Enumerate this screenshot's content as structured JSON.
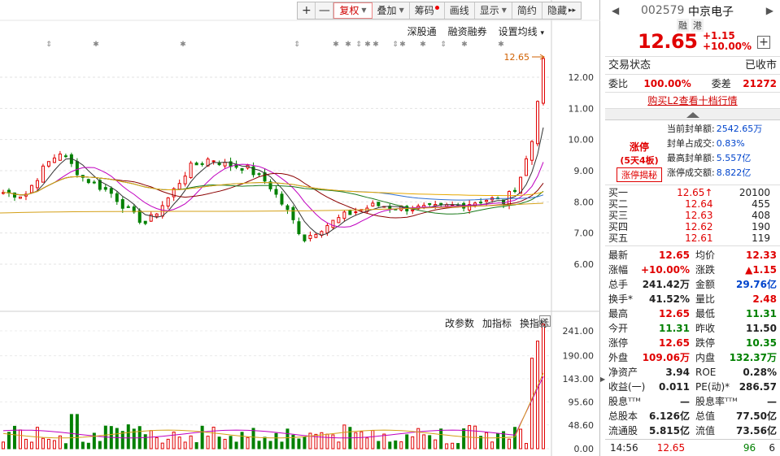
{
  "toolbar": {
    "plus": "+",
    "minus": "—",
    "fuquan": "复权",
    "diejia": "叠加",
    "chouma": "筹码",
    "huaxian": "画线",
    "xianshi": "显示",
    "jianyue": "简约",
    "yincang": "隐藏",
    "more": "▸▸"
  },
  "submenu": {
    "shengutong": "深股通",
    "rongzi": "融资融券",
    "junxian": "设置均线",
    "junxian_caret": "▾"
  },
  "indicator_menu": {
    "gaicanshu": "改参数",
    "jiazhibiao": "加指标",
    "huanzhibiao": "换指标",
    "close": "×"
  },
  "price_axis": [
    "12.00",
    "11.00",
    "10.00",
    "9.00",
    "8.00",
    "7.00",
    "6.00"
  ],
  "volume_axis": [
    "241.00",
    "190.00",
    "143.00",
    "95.60",
    "48.60",
    "0.00"
  ],
  "last_price_label": "12.65",
  "edge_toggle": "▶",
  "quote": {
    "prev": "◀",
    "next": "▶",
    "code": "002579",
    "name": "中京电子",
    "tag_rong": "融",
    "tag_gang": "港",
    "price": "12.65",
    "change": "+1.15",
    "change_pct": "+10.00%",
    "add": "+",
    "status_label": "交易状态",
    "status_value": "已收市",
    "weibi_label": "委比",
    "weibi_value": "100.00%",
    "weicha_label": "委差",
    "weicha_value": "21272",
    "l2_link": "购买L2查看十档行情",
    "limit": {
      "title": "涨停",
      "days": "(5天4板)",
      "button": "涨停揭秘",
      "rows": [
        {
          "k": "当前封单额:",
          "v": "2542.65万"
        },
        {
          "k": "封单占成交:",
          "v": "0.83%"
        },
        {
          "k": "最高封单额:",
          "v": "5.557亿"
        },
        {
          "k": "涨停成交额:",
          "v": "8.822亿"
        }
      ]
    },
    "book": [
      {
        "label": "买一",
        "price": "12.65↑",
        "vol": "20100"
      },
      {
        "label": "买二",
        "price": "12.64",
        "vol": "455"
      },
      {
        "label": "买三",
        "price": "12.63",
        "vol": "408"
      },
      {
        "label": "买四",
        "price": "12.62",
        "vol": "190"
      },
      {
        "label": "买五",
        "price": "12.61",
        "vol": "119"
      }
    ],
    "stats": [
      {
        "k1": "最新",
        "v1": "12.65",
        "c1": "red",
        "k2": "均价",
        "v2": "12.33",
        "c2": "red"
      },
      {
        "k1": "涨幅",
        "v1": "+10.00%",
        "c1": "red",
        "k2": "涨跌",
        "v2": "▲1.15",
        "c2": "red"
      },
      {
        "k1": "总手",
        "v1": "241.42万",
        "c1": "",
        "k2": "金额",
        "v2": "29.76亿",
        "c2": "blue"
      },
      {
        "k1": "换手*",
        "v1": "41.52%",
        "c1": "",
        "k2": "量比",
        "v2": "2.48",
        "c2": "red"
      },
      {
        "k1": "最高",
        "v1": "12.65",
        "c1": "red",
        "k2": "最低",
        "v2": "11.31",
        "c2": "green"
      },
      {
        "k1": "今开",
        "v1": "11.31",
        "c1": "green",
        "k2": "昨收",
        "v2": "11.50",
        "c2": ""
      },
      {
        "k1": "涨停",
        "v1": "12.65",
        "c1": "red",
        "k2": "跌停",
        "v2": "10.35",
        "c2": "green"
      },
      {
        "k1": "外盘",
        "v1": "109.06万",
        "c1": "red",
        "k2": "内盘",
        "v2": "132.37万",
        "c2": "green"
      },
      {
        "k1": "净资产",
        "v1": "3.94",
        "c1": "",
        "k2": "ROE",
        "v2": "0.28%",
        "c2": ""
      },
      {
        "k1": "收益(一)",
        "v1": "0.011",
        "c1": "",
        "k2": "PE(动)*",
        "v2": "286.57",
        "c2": ""
      },
      {
        "k1": "股息ᵀᵀᴹ",
        "v1": "—",
        "c1": "",
        "k2": "股息率ᵀᵀᴹ",
        "v2": "—",
        "c2": ""
      },
      {
        "k1": "总股本",
        "v1": "6.126亿",
        "c1": "",
        "k2": "总值",
        "v2": "77.50亿",
        "c2": ""
      },
      {
        "k1": "流通股",
        "v1": "5.815亿",
        "c1": "",
        "k2": "流值",
        "v2": "73.56亿",
        "c2": ""
      }
    ],
    "foot": {
      "time": "14:56",
      "price": "12.65",
      "vol": "96",
      "count": "6"
    }
  },
  "colors": {
    "up": "#e00000",
    "down": "#008000",
    "ma5": "#333333",
    "ma10": "#d4a017",
    "ma20": "#c000c0",
    "ma30": "#1a7a1a",
    "ma60": "#8b0000",
    "ma120": "#2f6fd0",
    "ma250": "#e6a800"
  }
}
